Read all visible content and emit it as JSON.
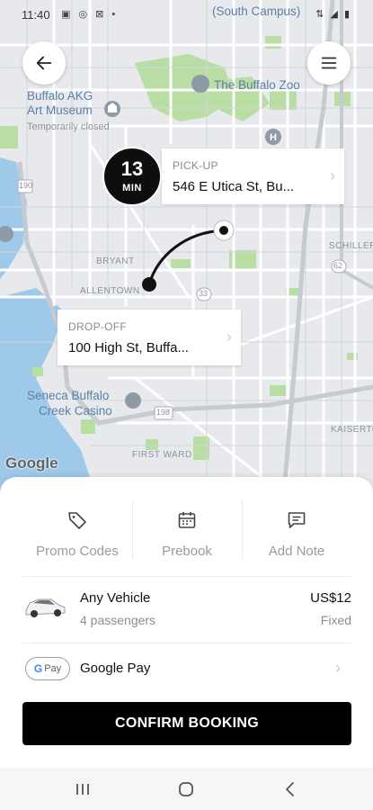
{
  "status_bar": {
    "time": "11:40",
    "notification_icons": "▣ ◎ ⊠ •",
    "right_icons": "⇅ ◢ ▮"
  },
  "map": {
    "labels": {
      "buffalo_akg": "Buffalo AKG",
      "art_museum": "Art Museum",
      "temporarily_closed": "Temporarily closed",
      "buffalo_zoo": "The Buffalo Zoo",
      "south_campus": "(South Campus)",
      "bryant": "BRYANT",
      "allentown": "ALLENTOWN",
      "seneca_buffalo": "Seneca Buffalo",
      "creek_casino": "Creek Casino",
      "first_ward": "FIRST WARD",
      "schiller": "SCHILLER",
      "kaisertown": "KAISERTOWN",
      "route_190": "190",
      "route_33": "33",
      "route_62": "62",
      "route_198": "198"
    },
    "attribution": "Google"
  },
  "eta": {
    "value": "13",
    "unit": "MIN"
  },
  "pickup": {
    "title": "PICK-UP",
    "address": "546 E Utica St, Bu..."
  },
  "dropoff": {
    "title": "DROP-OFF",
    "address": "100 High St, Buffa..."
  },
  "actions": [
    {
      "label": "Promo Codes",
      "icon": "tag-icon"
    },
    {
      "label": "Prebook",
      "icon": "calendar-icon"
    },
    {
      "label": "Add Note",
      "icon": "note-icon"
    }
  ],
  "vehicle": {
    "name": "Any Vehicle",
    "passengers": "4 passengers",
    "price": "US$12",
    "price_type": "Fixed"
  },
  "payment": {
    "badge_g": "G",
    "badge_text": "Pay",
    "name": "Google Pay"
  },
  "confirm_label": "CONFIRM BOOKING",
  "colors": {
    "map_bg": "#e7e9ec",
    "water": "#9ec9e8",
    "park": "#b8dea3",
    "route": "#111111",
    "button": "#000000"
  }
}
